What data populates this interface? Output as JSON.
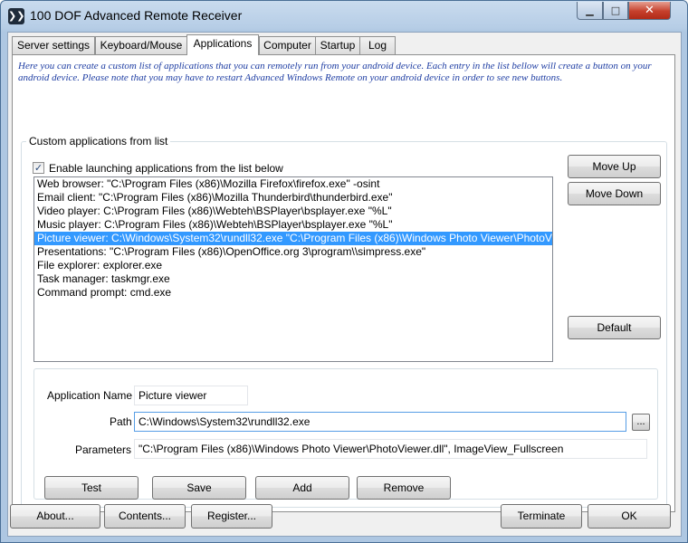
{
  "window": {
    "title": "100 DOF Advanced Remote Receiver",
    "icon": "app-logo-icon",
    "controls": {
      "minimize": "minimize-icon",
      "maximize": "maximize-icon",
      "close": "close-icon"
    }
  },
  "tabs": [
    {
      "label": "Server settings",
      "active": false
    },
    {
      "label": "Keyboard/Mouse",
      "active": false
    },
    {
      "label": "Applications",
      "active": true
    },
    {
      "label": "Computer",
      "active": false
    },
    {
      "label": "Startup",
      "active": false
    },
    {
      "label": "Log",
      "active": false
    }
  ],
  "info_text": "Here you can create a custom list of applications that you can remotely run from your android device. Each entry in the list bellow will create a button on your android device. Please note that you may have to restart Advanced Windows Remote on your android device in order to see new buttons.",
  "custom_group": {
    "title": "Custom applications from list",
    "enable_checkbox": {
      "label": "Enable launching applications from the list below",
      "checked": true
    },
    "list": [
      "Web browser: \"C:\\Program Files (x86)\\Mozilla Firefox\\firefox.exe\" -osint",
      "Email client: \"C:\\Program Files (x86)\\Mozilla Thunderbird\\thunderbird.exe\"",
      "Video player: C:\\Program Files (x86)\\Webteh\\BSPlayer\\bsplayer.exe \"%L\"",
      "Music player: C:\\Program Files (x86)\\Webteh\\BSPlayer\\bsplayer.exe \"%L\"",
      "Picture viewer: C:\\Windows\\System32\\rundll32.exe \"C:\\Program Files (x86)\\Windows Photo Viewer\\PhotoV",
      "Presentations: \"C:\\Program Files (x86)\\OpenOffice.org 3\\program\\\\simpress.exe\"",
      "File explorer: explorer.exe",
      "Task manager: taskmgr.exe",
      "Command prompt: cmd.exe"
    ],
    "selected_index": 4,
    "move_up_label": "Move Up",
    "move_down_label": "Move Down",
    "default_label": "Default"
  },
  "editor": {
    "name_label": "Application Name",
    "name_value": "Picture viewer",
    "path_label": "Path",
    "path_value": "C:\\Windows\\System32\\rundll32.exe",
    "browse_label": "...",
    "params_label": "Parameters",
    "params_value": "\"C:\\Program Files (x86)\\Windows Photo Viewer\\PhotoViewer.dll\", ImageView_Fullscreen",
    "test_label": "Test",
    "save_label": "Save",
    "add_label": "Add",
    "remove_label": "Remove"
  },
  "footer": {
    "about_label": "About...",
    "contents_label": "Contents...",
    "register_label": "Register...",
    "terminate_label": "Terminate",
    "ok_label": "OK"
  }
}
